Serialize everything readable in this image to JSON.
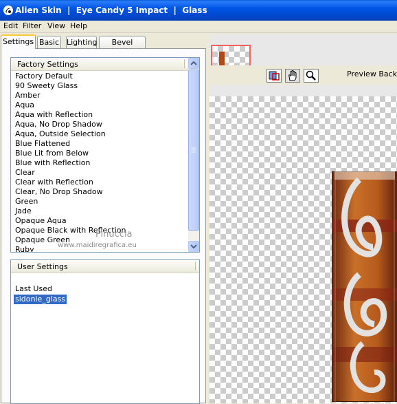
{
  "window": {
    "title": "Alien Skin  |  Eye Candy 5 Impact  |  Glass"
  },
  "menu": [
    "Edit",
    "Filter",
    "View",
    "Help"
  ],
  "tabs": [
    {
      "label": "Settings",
      "active": true
    },
    {
      "label": "Basic",
      "active": false
    },
    {
      "label": "Lighting",
      "active": false
    },
    {
      "label": "Bevel Profile",
      "active": false
    }
  ],
  "factory_settings": {
    "header": "Factory Settings",
    "items": [
      "Factory Default",
      "90 Sweety Glass",
      "Amber",
      "Aqua",
      "Aqua with Reflection",
      "Aqua, No Drop Shadow",
      "Aqua, Outside Selection",
      "Blue Flattened",
      "Blue Lit from Below",
      "Blue with Reflection",
      "Clear",
      "Clear with Reflection",
      "Clear, No Drop Shadow",
      "Green",
      "Jade",
      "Opaque Aqua",
      "Opaque Black with Reflection",
      "Opaque Green",
      "Ruby"
    ]
  },
  "user_settings": {
    "header": "User Settings",
    "items": [
      "Last Used",
      "sidonie_glass"
    ],
    "selected": "sidonie_glass"
  },
  "watermark": {
    "line1": "Pinuccia",
    "line2": "www.maidiregrafica.eu"
  },
  "preview": {
    "label": "Preview Backg"
  },
  "icons": [
    "eye-candy-app-icon",
    "navigator-icon",
    "hand-pan-icon",
    "zoom-magnifier-icon"
  ],
  "colors": {
    "title_bar": "#0055e5",
    "selection": "#316ac5",
    "nav_frame": "#ff6060",
    "artwork": "#b04a18"
  }
}
